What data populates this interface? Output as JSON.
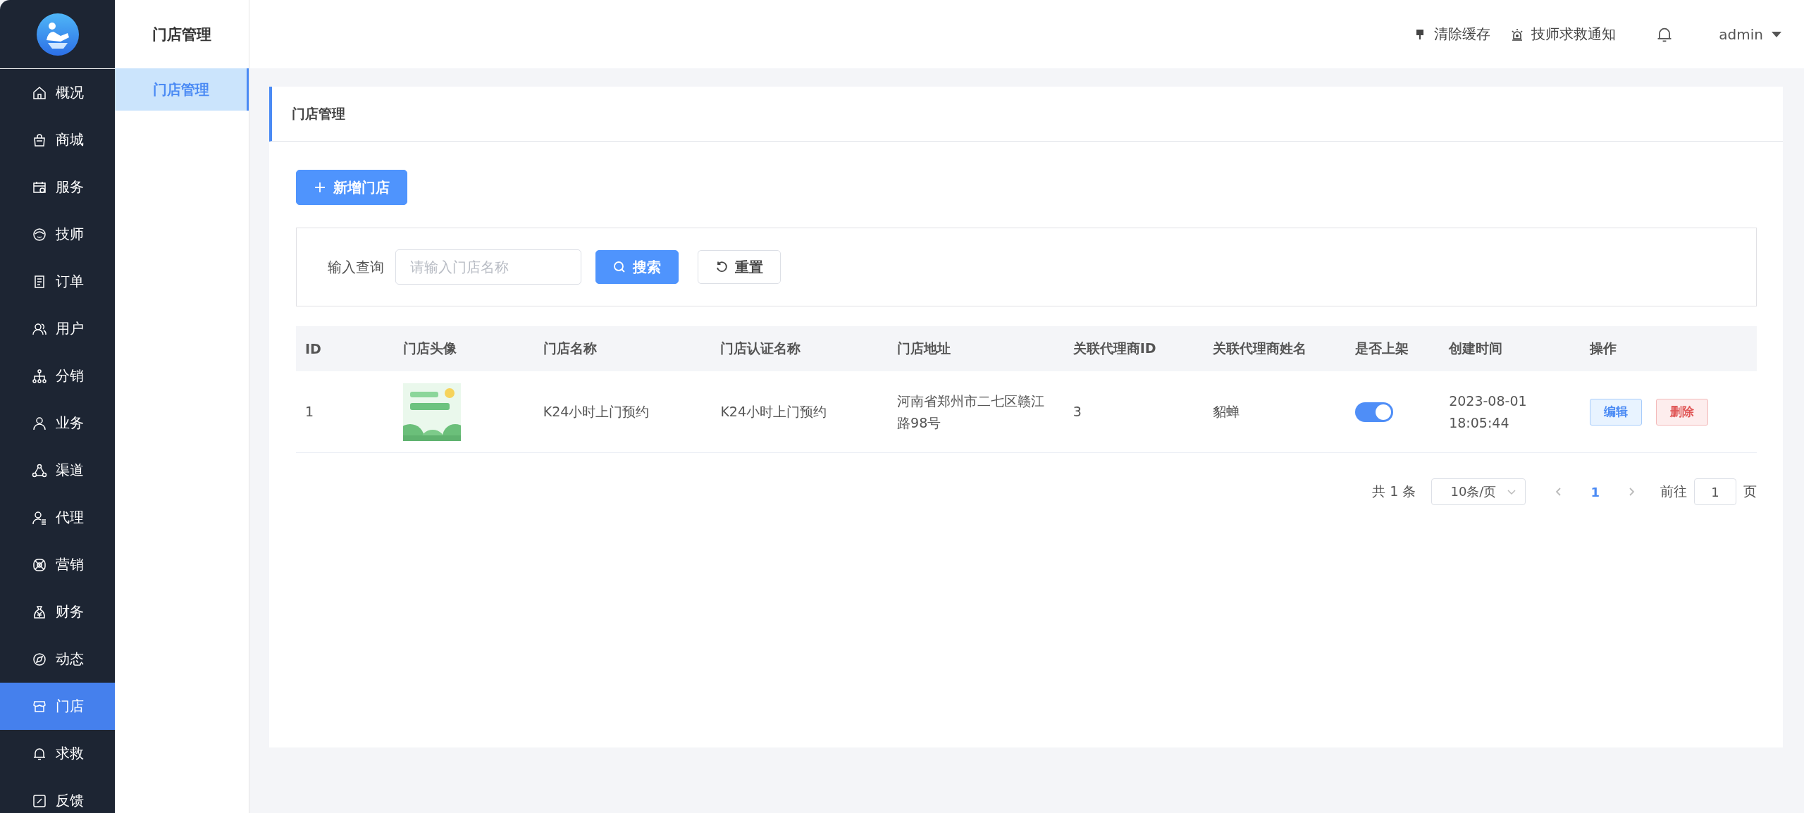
{
  "sidebar": {
    "items": [
      {
        "label": "概况",
        "selected": false
      },
      {
        "label": "商城",
        "selected": false
      },
      {
        "label": "服务",
        "selected": false
      },
      {
        "label": "技师",
        "selected": false
      },
      {
        "label": "订单",
        "selected": false
      },
      {
        "label": "用户",
        "selected": false
      },
      {
        "label": "分销",
        "selected": false
      },
      {
        "label": "业务",
        "selected": false
      },
      {
        "label": "渠道",
        "selected": false
      },
      {
        "label": "代理",
        "selected": false
      },
      {
        "label": "营销",
        "selected": false
      },
      {
        "label": "财务",
        "selected": false
      },
      {
        "label": "动态",
        "selected": false
      },
      {
        "label": "门店",
        "selected": true
      },
      {
        "label": "求救",
        "selected": false
      },
      {
        "label": "反馈",
        "selected": false
      }
    ]
  },
  "submenu": {
    "title": "门店管理",
    "items": [
      {
        "label": "门店管理",
        "selected": true
      }
    ]
  },
  "topbar": {
    "actions": [
      "清除缓存",
      "技师求救通知"
    ],
    "user": "admin"
  },
  "page": {
    "title": "门店管理",
    "add_button": "新增门店",
    "search": {
      "label": "输入查询",
      "placeholder": "请输入门店名称",
      "search_button": "搜索",
      "reset_button": "重置"
    },
    "table": {
      "columns": [
        "ID",
        "门店头像",
        "门店名称",
        "门店认证名称",
        "门店地址",
        "关联代理商ID",
        "关联代理商姓名",
        "是否上架",
        "创建时间",
        "操作"
      ],
      "rows": [
        {
          "id": "1",
          "name": "K24小时上门预约",
          "cert_name": "K24小时上门预约",
          "address": "河南省郑州市二七区赣江路98号",
          "agent_id": "3",
          "agent_name": "貂蝉",
          "on_shelf": true,
          "created": [
            "2023-08-01",
            "18:05:44"
          ],
          "actions": [
            "编辑",
            "删除"
          ]
        }
      ]
    },
    "pagination": {
      "total": "共 1 条",
      "page_size": "10条/页",
      "pages": [
        {
          "label": "1",
          "selected": true
        }
      ],
      "goto_label": "前往",
      "goto_value": "1",
      "goto_suffix": "页"
    }
  }
}
